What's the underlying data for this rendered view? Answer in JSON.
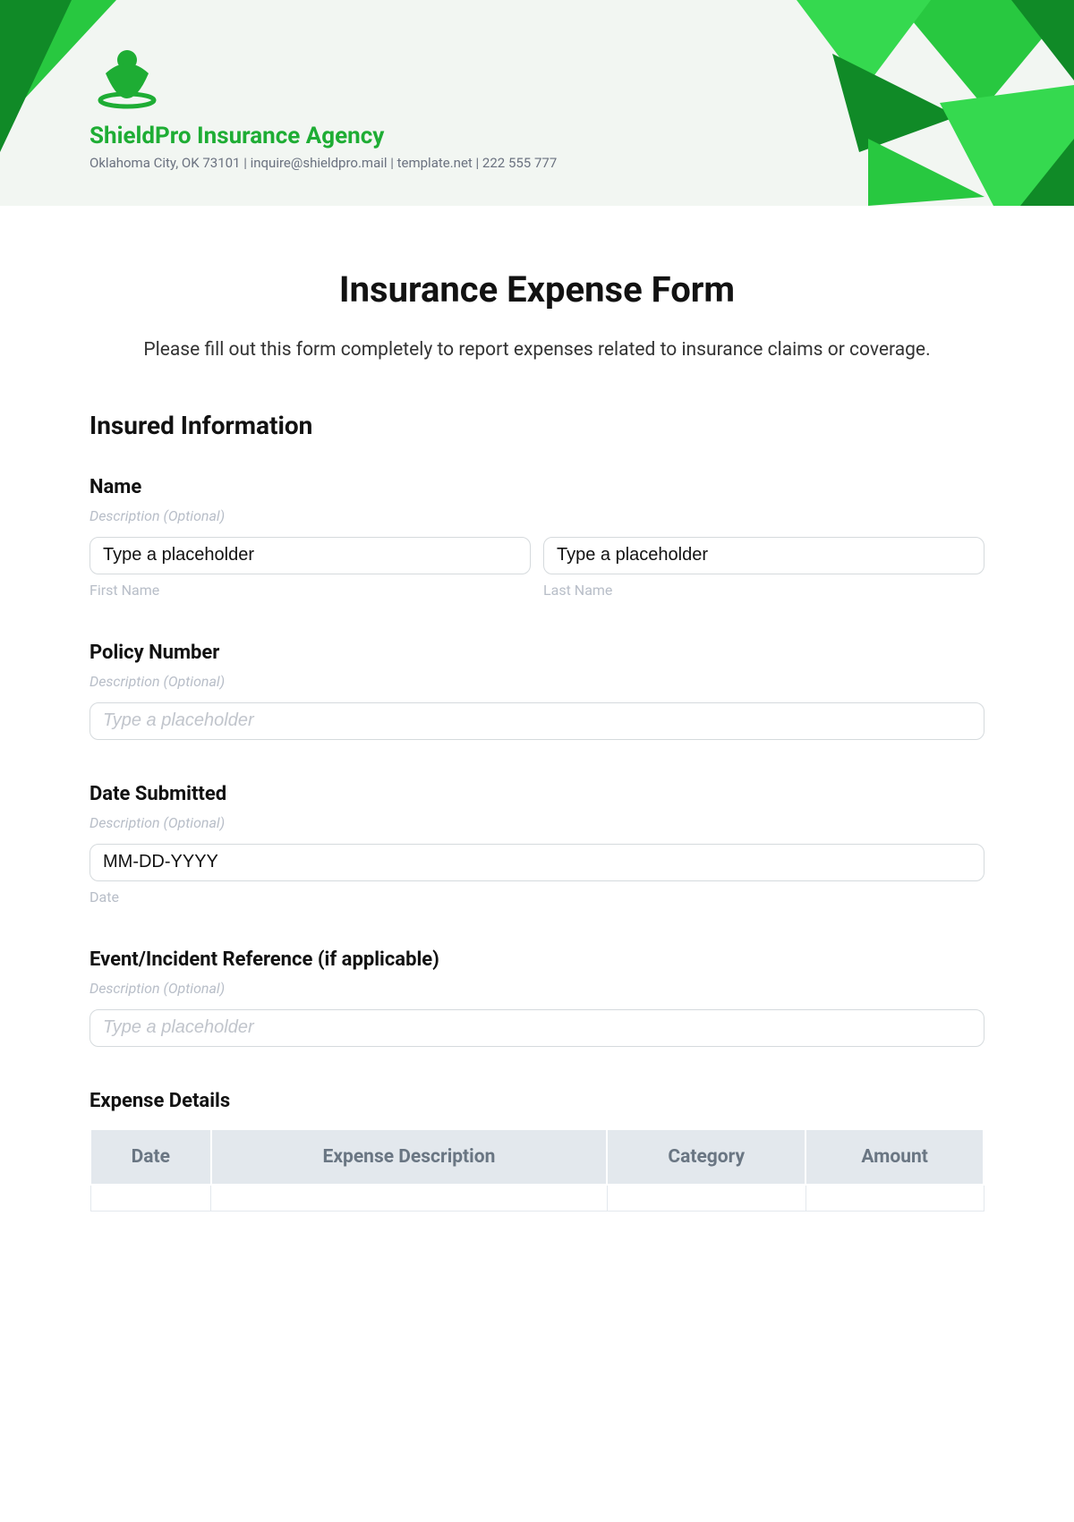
{
  "header": {
    "company": "ShieldPro Insurance Agency",
    "sub": "Oklahoma City, OK 73101 | inquire@shieldpro.mail | template.net | 222 555 777"
  },
  "form": {
    "title": "Insurance Expense Form",
    "intro": "Please fill out this form completely to report expenses related to insurance claims or coverage.",
    "section1": "Insured Information",
    "name": {
      "label": "Name",
      "desc": "Description (Optional)",
      "first_ph": "Type a placeholder",
      "last_ph": "Type a placeholder",
      "first_cap": "First Name",
      "last_cap": "Last Name"
    },
    "policy": {
      "label": "Policy Number",
      "desc": "Description (Optional)",
      "ph": "Type a placeholder"
    },
    "date": {
      "label": "Date Submitted",
      "desc": "Description (Optional)",
      "ph": "MM-DD-YYYY",
      "cap": "Date"
    },
    "event": {
      "label": "Event/Incident Reference (if applicable)",
      "desc": "Description (Optional)",
      "ph": "Type a placeholder"
    },
    "expense": {
      "heading": "Expense Details",
      "cols": [
        "Date",
        "Expense Description",
        "Category",
        "Amount"
      ]
    }
  }
}
